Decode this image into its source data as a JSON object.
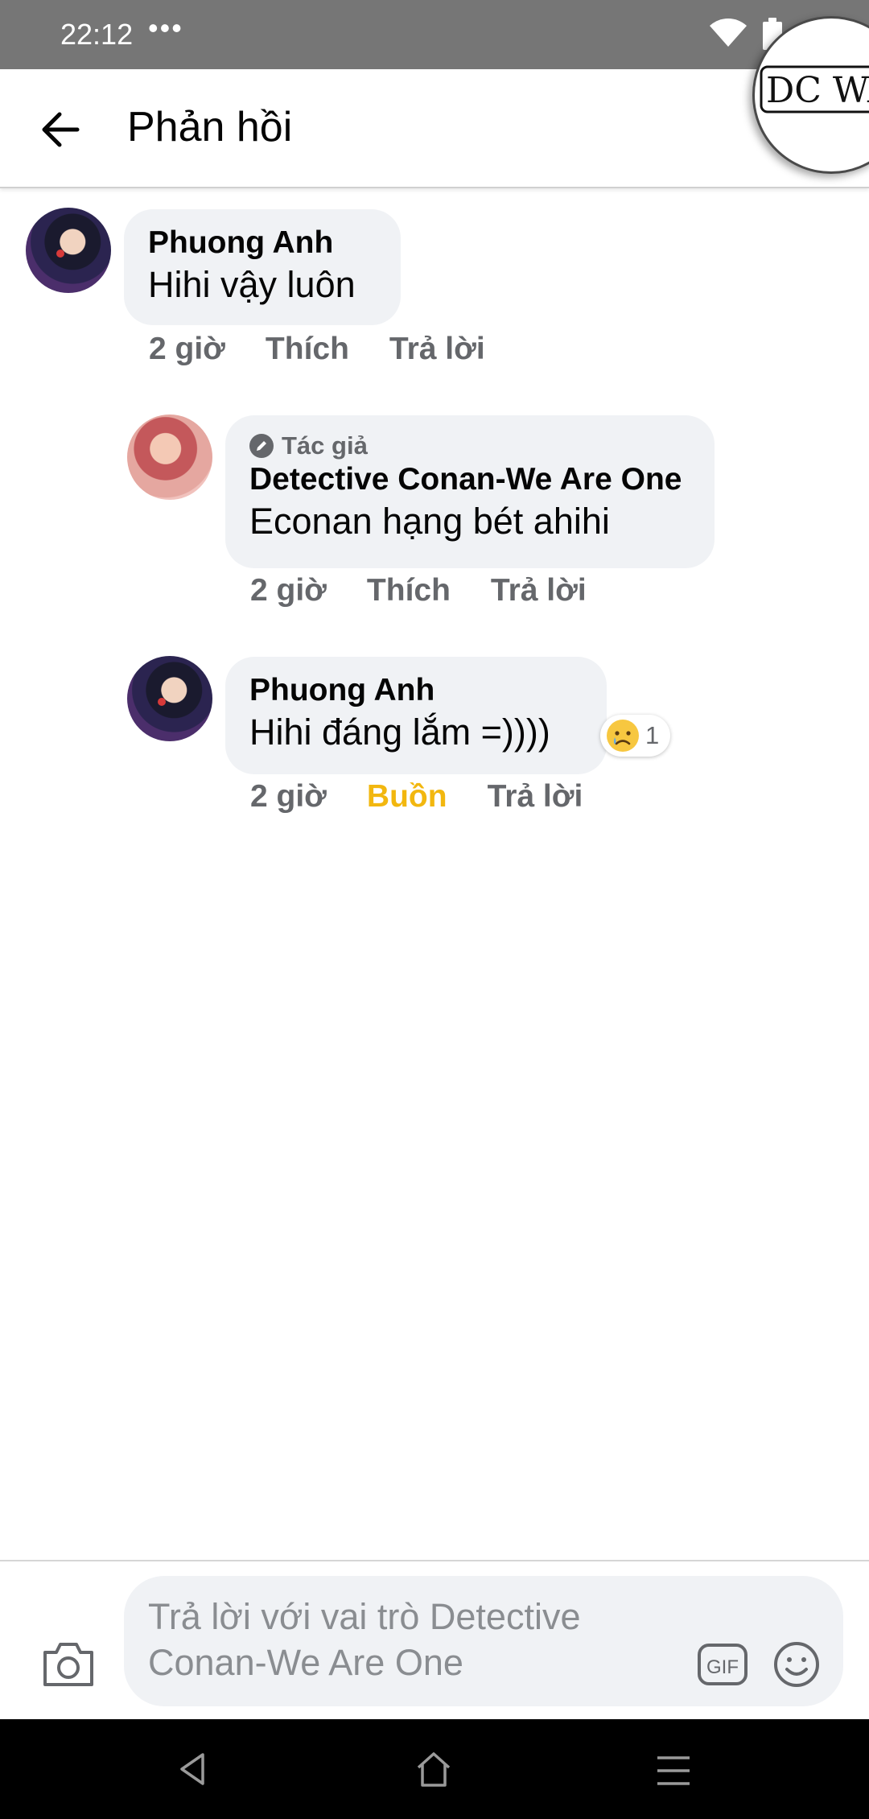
{
  "status_bar": {
    "time": "22:12",
    "dots": "•••"
  },
  "header": {
    "title": "Phản hồi",
    "badge_text": "DC WAO"
  },
  "comments": [
    {
      "author": "Phuong Anh",
      "text": "Hihi vậy luôn",
      "time": "2 giờ",
      "like_label": "Thích",
      "reply_label": "Trả lời"
    },
    {
      "author_badge": "Tác giả",
      "author": "Detective Conan-We Are One",
      "text": "Econan hạng bét ahihi",
      "time": "2 giờ",
      "like_label": "Thích",
      "reply_label": "Trả lời"
    },
    {
      "author": "Phuong Anh",
      "text": "Hihi đáng lắm =))))",
      "time": "2 giờ",
      "reaction_label": "Buồn",
      "reply_label": "Trả lời",
      "reaction_count": "1",
      "reaction_icon": "sad-emoji-icon"
    }
  ],
  "compose": {
    "placeholder": "Trả lời với vai trò Detective Conan-We Are One",
    "gif_label": "GIF"
  },
  "colors": {
    "bubble": "#f0f2f5",
    "secondary_text": "#65676b",
    "sad_reaction": "#f2b70f",
    "status_bar": "#767676"
  }
}
